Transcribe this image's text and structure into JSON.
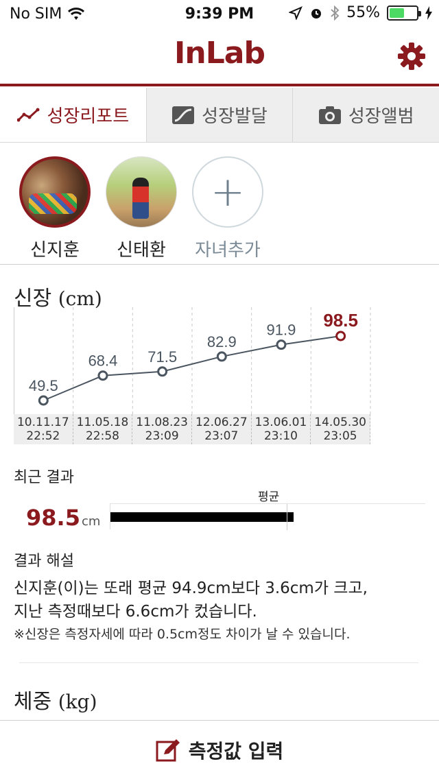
{
  "status_bar": {
    "carrier": "No SIM",
    "time": "9:39 PM",
    "battery_percent": "55%",
    "battery_level": 0.55
  },
  "header": {
    "logo": "InLab",
    "accent_color": "#8b1a1f"
  },
  "tabs": [
    {
      "label": "성장리포트",
      "icon": "trend-line-icon",
      "active": true
    },
    {
      "label": "성장발달",
      "icon": "growth-chart-icon",
      "active": false
    },
    {
      "label": "성장앨범",
      "icon": "camera-icon",
      "active": false
    }
  ],
  "children": [
    {
      "name": "신지훈",
      "selected": true
    },
    {
      "name": "신태환",
      "selected": false
    }
  ],
  "add_child_label": "자녀추가",
  "height_section": {
    "title": "신장",
    "unit": "(cm)"
  },
  "chart_data": {
    "type": "line",
    "title": "신장 (cm)",
    "categories": [
      "10.11.17 22:52",
      "11.05.18 22:58",
      "11.08.23 23:09",
      "12.06.27 23:07",
      "13.06.01 23:10",
      "14.05.30 23:05"
    ],
    "x_dates": [
      "10.11.17",
      "11.05.18",
      "11.08.23",
      "12.06.27",
      "13.06.01",
      "14.05.30"
    ],
    "x_times": [
      "22:52",
      "22:58",
      "23:09",
      "23:07",
      "23:10",
      "23:05"
    ],
    "values": [
      49.5,
      68.4,
      71.5,
      82.9,
      91.9,
      98.5
    ],
    "value_labels": [
      "49.5",
      "68.4",
      "71.5",
      "82.9",
      "91.9",
      "98.5"
    ],
    "highlight_last": true,
    "line_color": "#4a5560",
    "highlight_color": "#8b1a1f",
    "grid": "vertical-dashed"
  },
  "recent_result": {
    "label": "최근 결과",
    "value": "98.5",
    "unit": "cm",
    "average_label": "평균",
    "average_value": 94.9,
    "value_number": 98.5
  },
  "interpretation": {
    "title": "결과 해설",
    "line1": "신지훈(이)는 또래 평균 94.9cm보다 3.6cm가 크고,",
    "line2": "지난 측정때보다 6.6cm가 컸습니다.",
    "note": "※신장은 측정자세에 따라 0.5cm정도 차이가 날 수 있습니다."
  },
  "weight_section": {
    "title": "체중",
    "unit": "(kg)"
  },
  "bottom_action": {
    "label": "측정값 입력",
    "icon": "edit-icon"
  }
}
